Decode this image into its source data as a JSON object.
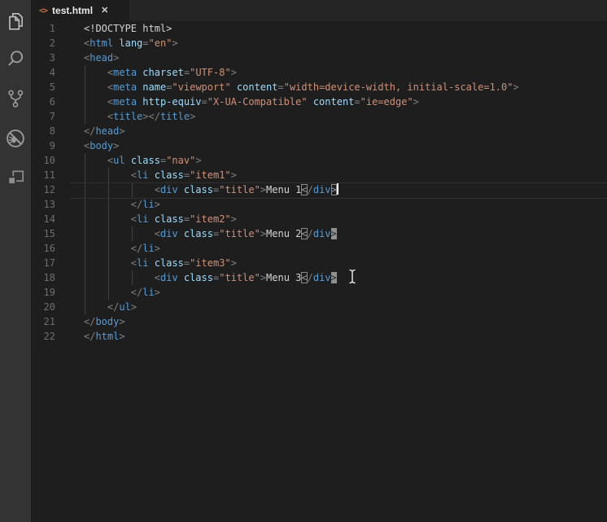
{
  "tab_bar": {
    "tabs": [
      {
        "name": "test.html",
        "icon": "html-angle-brackets-icon",
        "icon_glyph": "<>",
        "close_glyph": "✕",
        "active": true
      }
    ]
  },
  "activity_bar": {
    "items": [
      {
        "name": "explorer",
        "icon": "files-icon"
      },
      {
        "name": "search",
        "icon": "search-icon"
      },
      {
        "name": "source-control",
        "icon": "git-branch-icon"
      },
      {
        "name": "debug",
        "icon": "debug-bug-icon"
      },
      {
        "name": "extensions",
        "icon": "extensions-icon"
      }
    ]
  },
  "editor": {
    "language": "html",
    "cursor": {
      "line": 12,
      "column": 43
    },
    "current_line": 12,
    "mouse_cursor": "i-beam",
    "lines": [
      {
        "n": "1",
        "guides": [],
        "tokens": [
          [
            "d",
            "<!DOCTYPE html>"
          ]
        ]
      },
      {
        "n": "2",
        "guides": [],
        "tokens": [
          [
            "p",
            "<"
          ],
          [
            "g",
            "html"
          ],
          [
            "x",
            " "
          ],
          [
            "a",
            "lang"
          ],
          [
            "p",
            "="
          ],
          [
            "s",
            "\"en\""
          ],
          [
            "p",
            ">"
          ]
        ]
      },
      {
        "n": "3",
        "guides": [],
        "tokens": [
          [
            "p",
            "<"
          ],
          [
            "g",
            "head"
          ],
          [
            "p",
            ">"
          ]
        ]
      },
      {
        "n": "4",
        "guides": [
          0
        ],
        "tokens": [
          [
            "x",
            "    "
          ],
          [
            "p",
            "<"
          ],
          [
            "g",
            "meta"
          ],
          [
            "x",
            " "
          ],
          [
            "a",
            "charset"
          ],
          [
            "p",
            "="
          ],
          [
            "s",
            "\"UTF-8\""
          ],
          [
            "p",
            ">"
          ]
        ]
      },
      {
        "n": "5",
        "guides": [
          0
        ],
        "tokens": [
          [
            "x",
            "    "
          ],
          [
            "p",
            "<"
          ],
          [
            "g",
            "meta"
          ],
          [
            "x",
            " "
          ],
          [
            "a",
            "name"
          ],
          [
            "p",
            "="
          ],
          [
            "s",
            "\"viewport\""
          ],
          [
            "x",
            " "
          ],
          [
            "a",
            "content"
          ],
          [
            "p",
            "="
          ],
          [
            "s",
            "\"width=device-width, initial-scale=1.0\""
          ],
          [
            "p",
            ">"
          ]
        ]
      },
      {
        "n": "6",
        "guides": [
          0
        ],
        "tokens": [
          [
            "x",
            "    "
          ],
          [
            "p",
            "<"
          ],
          [
            "g",
            "meta"
          ],
          [
            "x",
            " "
          ],
          [
            "a",
            "http-equiv"
          ],
          [
            "p",
            "="
          ],
          [
            "s",
            "\"X-UA-Compatible\""
          ],
          [
            "x",
            " "
          ],
          [
            "a",
            "content"
          ],
          [
            "p",
            "="
          ],
          [
            "s",
            "\"ie=edge\""
          ],
          [
            "p",
            ">"
          ]
        ]
      },
      {
        "n": "7",
        "guides": [
          0
        ],
        "tokens": [
          [
            "x",
            "    "
          ],
          [
            "p",
            "<"
          ],
          [
            "g",
            "title"
          ],
          [
            "p",
            "></"
          ],
          [
            "g",
            "title"
          ],
          [
            "p",
            ">"
          ]
        ]
      },
      {
        "n": "8",
        "guides": [],
        "tokens": [
          [
            "p",
            "</"
          ],
          [
            "g",
            "head"
          ],
          [
            "p",
            ">"
          ]
        ]
      },
      {
        "n": "9",
        "guides": [],
        "tokens": [
          [
            "p",
            "<"
          ],
          [
            "g",
            "body"
          ],
          [
            "p",
            ">"
          ]
        ]
      },
      {
        "n": "10",
        "guides": [
          0
        ],
        "tokens": [
          [
            "x",
            "    "
          ],
          [
            "p",
            "<"
          ],
          [
            "g",
            "ul"
          ],
          [
            "x",
            " "
          ],
          [
            "a",
            "class"
          ],
          [
            "p",
            "="
          ],
          [
            "s",
            "\"nav\""
          ],
          [
            "p",
            ">"
          ]
        ]
      },
      {
        "n": "11",
        "guides": [
          0,
          4
        ],
        "tokens": [
          [
            "x",
            "        "
          ],
          [
            "p",
            "<"
          ],
          [
            "g",
            "li"
          ],
          [
            "x",
            " "
          ],
          [
            "a",
            "class"
          ],
          [
            "p",
            "="
          ],
          [
            "s",
            "\"item1\""
          ],
          [
            "p",
            ">"
          ]
        ]
      },
      {
        "n": "12",
        "guides": [
          0,
          4,
          8
        ],
        "current": true,
        "caret": true,
        "tokens": [
          [
            "x",
            "            "
          ],
          [
            "p",
            "<"
          ],
          [
            "g",
            "div"
          ],
          [
            "x",
            " "
          ],
          [
            "a",
            "class"
          ],
          [
            "p",
            "="
          ],
          [
            "s",
            "\"title\""
          ],
          [
            "p",
            ">"
          ],
          [
            "x",
            "Menu 1"
          ],
          [
            "bo",
            "<"
          ],
          [
            "p",
            "/"
          ],
          [
            "g",
            "div"
          ],
          [
            "bo",
            ">"
          ]
        ]
      },
      {
        "n": "13",
        "guides": [
          0,
          4
        ],
        "tokens": [
          [
            "x",
            "        "
          ],
          [
            "p",
            "</"
          ],
          [
            "g",
            "li"
          ],
          [
            "p",
            ">"
          ]
        ]
      },
      {
        "n": "14",
        "guides": [
          0,
          4
        ],
        "tokens": [
          [
            "x",
            "        "
          ],
          [
            "p",
            "<"
          ],
          [
            "g",
            "li"
          ],
          [
            "x",
            " "
          ],
          [
            "a",
            "class"
          ],
          [
            "p",
            "="
          ],
          [
            "s",
            "\"item2\""
          ],
          [
            "p",
            ">"
          ]
        ]
      },
      {
        "n": "15",
        "guides": [
          0,
          4,
          8
        ],
        "tokens": [
          [
            "x",
            "            "
          ],
          [
            "p",
            "<"
          ],
          [
            "g",
            "div"
          ],
          [
            "x",
            " "
          ],
          [
            "a",
            "class"
          ],
          [
            "p",
            "="
          ],
          [
            "s",
            "\"title\""
          ],
          [
            "p",
            ">"
          ],
          [
            "x",
            "Menu 2"
          ],
          [
            "bo",
            "<"
          ],
          [
            "p",
            "/"
          ],
          [
            "g",
            "div"
          ],
          [
            "bf",
            ">"
          ]
        ]
      },
      {
        "n": "16",
        "guides": [
          0,
          4
        ],
        "tokens": [
          [
            "x",
            "        "
          ],
          [
            "p",
            "</"
          ],
          [
            "g",
            "li"
          ],
          [
            "p",
            ">"
          ]
        ]
      },
      {
        "n": "17",
        "guides": [
          0,
          4
        ],
        "tokens": [
          [
            "x",
            "        "
          ],
          [
            "p",
            "<"
          ],
          [
            "g",
            "li"
          ],
          [
            "x",
            " "
          ],
          [
            "a",
            "class"
          ],
          [
            "p",
            "="
          ],
          [
            "s",
            "\"item3\""
          ],
          [
            "p",
            ">"
          ]
        ]
      },
      {
        "n": "18",
        "guides": [
          0,
          4,
          8
        ],
        "tokens": [
          [
            "x",
            "            "
          ],
          [
            "p",
            "<"
          ],
          [
            "g",
            "div"
          ],
          [
            "x",
            " "
          ],
          [
            "a",
            "class"
          ],
          [
            "p",
            "="
          ],
          [
            "s",
            "\"title\""
          ],
          [
            "p",
            ">"
          ],
          [
            "x",
            "Menu 3"
          ],
          [
            "bo",
            "<"
          ],
          [
            "p",
            "/"
          ],
          [
            "g",
            "div"
          ],
          [
            "bf",
            ">"
          ]
        ]
      },
      {
        "n": "19",
        "guides": [
          0,
          4
        ],
        "tokens": [
          [
            "x",
            "        "
          ],
          [
            "p",
            "</"
          ],
          [
            "g",
            "li"
          ],
          [
            "p",
            ">"
          ]
        ]
      },
      {
        "n": "20",
        "guides": [
          0
        ],
        "tokens": [
          [
            "x",
            "    "
          ],
          [
            "p",
            "</"
          ],
          [
            "g",
            "ul"
          ],
          [
            "p",
            ">"
          ]
        ]
      },
      {
        "n": "21",
        "guides": [],
        "tokens": [
          [
            "p",
            "</"
          ],
          [
            "g",
            "body"
          ],
          [
            "p",
            ">"
          ]
        ]
      },
      {
        "n": "22",
        "guides": [],
        "tokens": [
          [
            "p",
            "</"
          ],
          [
            "g",
            "html"
          ],
          [
            "p",
            ">"
          ]
        ]
      }
    ]
  },
  "colors": {
    "editor_background": "#1e1e1e",
    "activity_bar_background": "#333333",
    "tab_strip_background": "#252526",
    "tag": "#569cd6",
    "attribute": "#9cdcfe",
    "string": "#ce9178",
    "punctuation": "#808080",
    "plain_text": "#d4d4d4",
    "line_number": "#6e6e6e",
    "html_file_icon": "#cf703c"
  }
}
